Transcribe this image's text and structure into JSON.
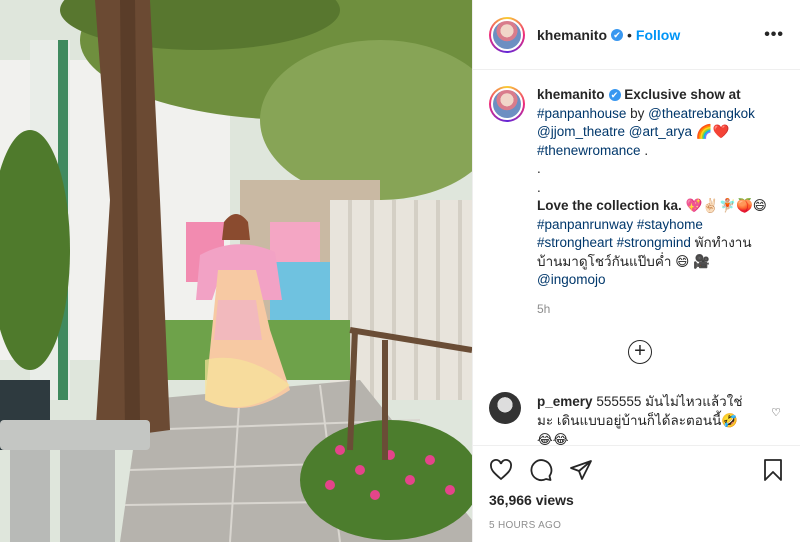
{
  "post": {
    "username": "khemanito",
    "verified_mark": "✔",
    "separator": "•",
    "follow_label": "Follow",
    "more_label": "•••"
  },
  "caption": {
    "username": "khemanito",
    "line1": "Exclusive show at",
    "tag_panpanhouse": "#panpanhouse",
    "by": "by",
    "mention_theatre": "@theatrebangkok",
    "mention_jjom": "@jjom_theatre",
    "mention_art": "@art_arya",
    "emoji1": "🌈❤️",
    "tag_newromance": "#thenewromance",
    "end_dot": ".",
    "dot_line1": ".",
    "dot_line2": ".",
    "love_line": "Love the collection ka.",
    "emoji2": "💖✌🏻🧚🏼🍑😄",
    "tag_runway": "#panpanrunway",
    "tag_stayhome": "#stayhome",
    "tag_strongheart": "#strongheart",
    "tag_strongmind": "#strongmind",
    "thai_line1": "พักทำงาน",
    "thai_line2": "บ้านมาดูโชว์กันแป๊บค่ำ",
    "emoji3": "😄 🎥",
    "mention_ingo": "@ingomojo",
    "time": "5h"
  },
  "comment": {
    "username": "p_emery",
    "text": "555555 มันไม่ไหวแล้วใช่มะ เดินแบบอยู่บ้านก็ได้ละตอนนี้🤣",
    "extra_emoji": "😂😂",
    "like_icon": "♡"
  },
  "icons": {
    "more_comments": "plus-circle-icon",
    "like": "heart-icon",
    "comment": "comment-icon",
    "share": "share-icon",
    "save": "bookmark-icon"
  },
  "plus_label": "+",
  "stats": {
    "views": "36,966 views",
    "posted": "5 HOURS AGO"
  }
}
